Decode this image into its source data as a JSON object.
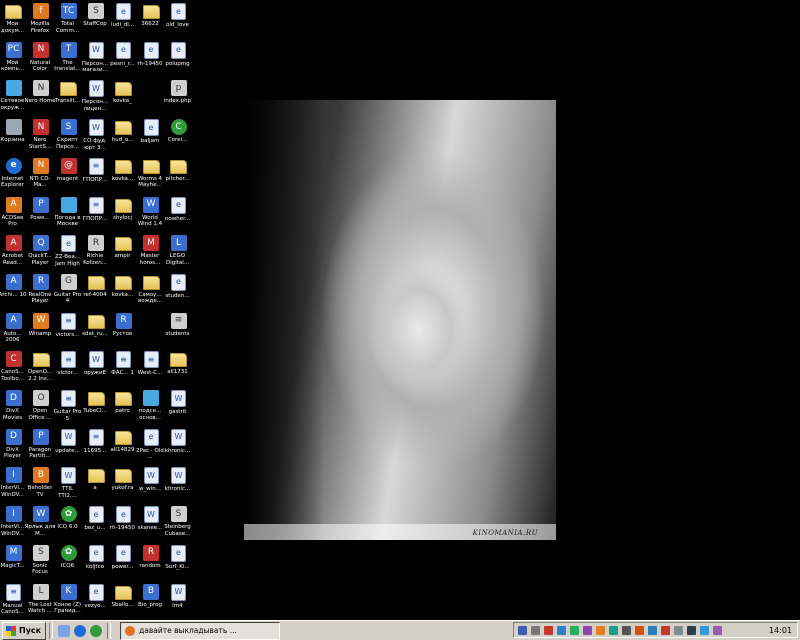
{
  "desktop": {
    "icons": [
      {
        "label": "Мои докум...",
        "icon": "folder",
        "glyph": ""
      },
      {
        "label": "Mozilla Firefox",
        "icon": "orange",
        "glyph": "f"
      },
      {
        "label": "Total Comm...",
        "icon": "app",
        "glyph": "TC"
      },
      {
        "label": "StaffCop",
        "icon": "gray",
        "glyph": "S"
      },
      {
        "label": "ludi_dl...",
        "icon": "doc",
        "glyph": "e"
      },
      {
        "label": "36622",
        "icon": "folder",
        "glyph": ""
      },
      {
        "label": "old_love",
        "icon": "doc",
        "glyph": "e"
      },
      {
        "label": "Мой компь...",
        "icon": "app",
        "glyph": "PC"
      },
      {
        "label": "Natural Color",
        "icon": "red",
        "glyph": "N"
      },
      {
        "label": "The translat...",
        "icon": "app",
        "glyph": "T"
      },
      {
        "label": "Персон... магази...",
        "icon": "doc",
        "glyph": "W"
      },
      {
        "label": "pesni_r...",
        "icon": "doc",
        "glyph": "e"
      },
      {
        "label": "rh-19450",
        "icon": "doc",
        "glyph": "e"
      },
      {
        "label": "polupmg",
        "icon": "doc",
        "glyph": "e"
      },
      {
        "label": "Сетевое окруж...",
        "icon": "net",
        "glyph": ""
      },
      {
        "label": "Nero Home",
        "icon": "gray",
        "glyph": "N"
      },
      {
        "label": "Translit...",
        "icon": "folder",
        "glyph": ""
      },
      {
        "label": "Персон... лицен...",
        "icon": "doc",
        "glyph": "W"
      },
      {
        "label": "kovka_",
        "icon": "folder",
        "glyph": ""
      },
      {
        "label": "",
        "icon": "none",
        "glyph": ""
      },
      {
        "label": "index.php",
        "icon": "gray",
        "glyph": "p"
      },
      {
        "label": "Корзина",
        "icon": "bin",
        "glyph": ""
      },
      {
        "label": "Nero StartS...",
        "icon": "red",
        "glyph": "N"
      },
      {
        "label": "Скрипт Персо...",
        "icon": "app",
        "glyph": "S"
      },
      {
        "label": "СО фуд. юрт 3...",
        "icon": "doc",
        "glyph": "W"
      },
      {
        "label": "hud_o...",
        "icon": "folder",
        "glyph": ""
      },
      {
        "label": "baljam",
        "icon": "doc",
        "glyph": "e"
      },
      {
        "label": "Corel...",
        "icon": "green",
        "glyph": "C"
      },
      {
        "label": "Internet Explorer",
        "icon": "ie",
        "glyph": "e"
      },
      {
        "label": "NTI CD-Ma...",
        "icon": "orange",
        "glyph": "N"
      },
      {
        "label": "magent",
        "icon": "red",
        "glyph": "@"
      },
      {
        "label": "ГПОПР...",
        "icon": "doc",
        "glyph": "≡"
      },
      {
        "label": "kovka...",
        "icon": "folder",
        "glyph": ""
      },
      {
        "label": "Worms 4 Mayhe...",
        "icon": "folder",
        "glyph": ""
      },
      {
        "label": "pitcher...",
        "icon": "folder",
        "glyph": ""
      },
      {
        "label": "ACDSee Pro",
        "icon": "orange",
        "glyph": "A"
      },
      {
        "label": "Powe...",
        "icon": "app",
        "glyph": "P"
      },
      {
        "label": "Погода в Москве",
        "icon": "net",
        "glyph": ""
      },
      {
        "label": "ГПОПР...",
        "icon": "doc",
        "glyph": "≡"
      },
      {
        "label": "shylocj",
        "icon": "folder",
        "glyph": ""
      },
      {
        "label": "World Wind 1.4",
        "icon": "app",
        "glyph": "W"
      },
      {
        "label": "nowher...",
        "icon": "doc",
        "glyph": "e"
      },
      {
        "label": "Acrobat Read...",
        "icon": "red",
        "glyph": "A"
      },
      {
        "label": "QuickT... Player",
        "icon": "app",
        "glyph": "Q"
      },
      {
        "label": "ZZ-Bea... Jam High",
        "icon": "doc",
        "glyph": "e"
      },
      {
        "label": "Richie Kotzen...",
        "icon": "gray",
        "glyph": "R"
      },
      {
        "label": "ampir",
        "icon": "folder",
        "glyph": ""
      },
      {
        "label": "Master horos...",
        "icon": "red",
        "glyph": "M"
      },
      {
        "label": "LEGO Digital...",
        "icon": "app",
        "glyph": "L"
      },
      {
        "label": "Archi... 10",
        "icon": "app",
        "glyph": "A"
      },
      {
        "label": "RealOne Player",
        "icon": "app",
        "glyph": "R"
      },
      {
        "label": "Guitar Pro 4",
        "icon": "gray",
        "glyph": "G"
      },
      {
        "label": "ref-4004",
        "icon": "folder",
        "glyph": ""
      },
      {
        "label": "kovka...",
        "icon": "folder",
        "glyph": ""
      },
      {
        "label": "Самоу... вожде...",
        "icon": "folder",
        "glyph": ""
      },
      {
        "label": "studen...",
        "icon": "doc",
        "glyph": "e"
      },
      {
        "label": "Auto... 2006",
        "icon": "app",
        "glyph": "A"
      },
      {
        "label": "Winamp",
        "icon": "orange",
        "glyph": "W"
      },
      {
        "label": "victors...",
        "icon": "doc",
        "glyph": "≡"
      },
      {
        "label": "sdat_ru...",
        "icon": "folder",
        "glyph": ""
      },
      {
        "label": "Рустов",
        "icon": "app",
        "glyph": "R"
      },
      {
        "label": "",
        "icon": "none",
        "glyph": ""
      },
      {
        "label": "students",
        "icon": "gray",
        "glyph": "≡"
      },
      {
        "label": "CanoS... Toolbo...",
        "icon": "red",
        "glyph": "C"
      },
      {
        "label": "OpenO... 2.2 Ins...",
        "icon": "folder",
        "glyph": ""
      },
      {
        "label": "victor...",
        "icon": "doc",
        "glyph": "≡"
      },
      {
        "label": "оружиЕ",
        "icon": "doc",
        "glyph": "W"
      },
      {
        "label": "ФАС... 1",
        "icon": "doc",
        "glyph": "≡"
      },
      {
        "label": "West-C...",
        "icon": "doc",
        "glyph": "≡"
      },
      {
        "label": "all1731",
        "icon": "folder",
        "glyph": ""
      },
      {
        "label": "DivX Movies",
        "icon": "app",
        "glyph": "D"
      },
      {
        "label": "Open Office ...",
        "icon": "gray",
        "glyph": "O"
      },
      {
        "label": "Guitar Pro 5",
        "icon": "doc",
        "glyph": "≡"
      },
      {
        "label": "TubeCl...",
        "icon": "folder",
        "glyph": ""
      },
      {
        "label": "patro",
        "icon": "folder",
        "glyph": ""
      },
      {
        "label": "подсе... основ...",
        "icon": "net",
        "glyph": ""
      },
      {
        "label": "gastrit",
        "icon": "doc",
        "glyph": "W"
      },
      {
        "label": "DivX Player",
        "icon": "app",
        "glyph": "D"
      },
      {
        "label": "Paragon Partiti...",
        "icon": "app",
        "glyph": "P"
      },
      {
        "label": "update...",
        "icon": "doc",
        "glyph": "W"
      },
      {
        "label": "11695...",
        "icon": "doc",
        "glyph": "≡"
      },
      {
        "label": "all14829",
        "icon": "folder",
        "glyph": ""
      },
      {
        "label": "2Pac - Old ...",
        "icon": "doc",
        "glyph": "e"
      },
      {
        "label": "khronic...",
        "icon": "doc",
        "glyph": "W"
      },
      {
        "label": "InterVi... WinDV...",
        "icon": "app",
        "glyph": "I"
      },
      {
        "label": "Beholder TV",
        "icon": "orange",
        "glyph": "B"
      },
      {
        "label": "TTIL TTI2,...",
        "icon": "doc",
        "glyph": "W"
      },
      {
        "label": "a",
        "icon": "folder",
        "glyph": ""
      },
      {
        "label": "yukof.ra",
        "icon": "folder",
        "glyph": ""
      },
      {
        "label": "w_win...",
        "icon": "doc",
        "glyph": "W"
      },
      {
        "label": "khronic...",
        "icon": "doc",
        "glyph": "W"
      },
      {
        "label": "InterVi... WinDV...",
        "icon": "app",
        "glyph": "I"
      },
      {
        "label": "Ярлык для M...",
        "icon": "app",
        "glyph": "W"
      },
      {
        "label": "ICQ 6.0",
        "icon": "green",
        "glyph": "✿"
      },
      {
        "label": "bez_u...",
        "icon": "doc",
        "glyph": "e"
      },
      {
        "label": "rh-19450",
        "icon": "doc",
        "glyph": "e"
      },
      {
        "label": "skanee...",
        "icon": "doc",
        "glyph": "W"
      },
      {
        "label": "Steinberg Cubase...",
        "icon": "gray",
        "glyph": "S"
      },
      {
        "label": "MagicT...",
        "icon": "app",
        "glyph": "M"
      },
      {
        "label": "Sonic Focus",
        "icon": "gray",
        "glyph": "S"
      },
      {
        "label": "ICQ6",
        "icon": "green",
        "glyph": "✿"
      },
      {
        "label": "koljtco",
        "icon": "doc",
        "glyph": "e"
      },
      {
        "label": "power...",
        "icon": "doc",
        "glyph": "e"
      },
      {
        "label": "random",
        "icon": "red",
        "glyph": "R"
      },
      {
        "label": "Surf_Ki...",
        "icon": "doc",
        "glyph": "e"
      },
      {
        "label": "Manual CanoS...",
        "icon": "doc",
        "glyph": "≡"
      },
      {
        "label": "The Lost Watch ...",
        "icon": "gray",
        "glyph": "L"
      },
      {
        "label": "Kоное (Z) Гранид...",
        "icon": "app",
        "glyph": "K"
      },
      {
        "label": "vezyo...",
        "icon": "doc",
        "glyph": "e"
      },
      {
        "label": "Sballo...",
        "icon": "folder",
        "glyph": ""
      },
      {
        "label": "Bio_prog",
        "icon": "app",
        "glyph": "B"
      },
      {
        "label": "lm4",
        "icon": "doc",
        "glyph": "W"
      }
    ],
    "wallpaper": {
      "watermark": "KINOMANIA.RU"
    }
  },
  "taskbar": {
    "start_label": "Пуск",
    "active_task": "давайте выкладывать ...",
    "clock": "14:01"
  },
  "colors": {
    "taskbar": "#d4d0c8",
    "desktop": "#000000"
  }
}
